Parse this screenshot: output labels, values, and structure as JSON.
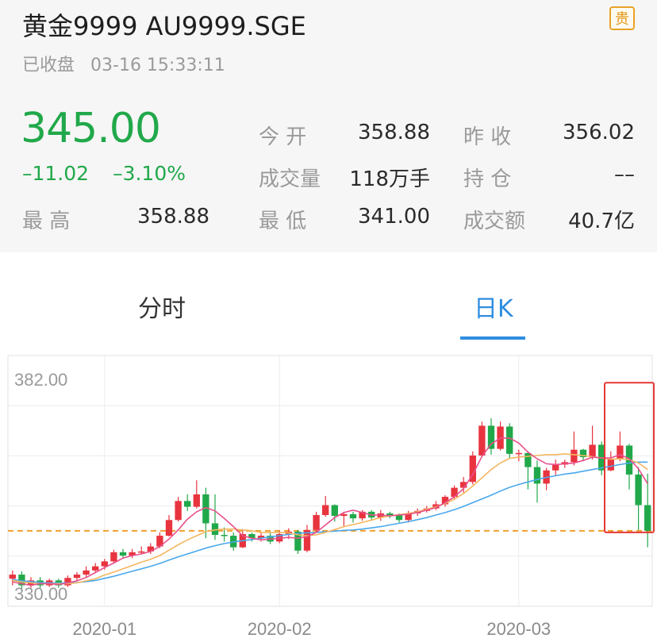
{
  "quote": {
    "title": "黄金9999 AU9999.SGE",
    "badge": "贵",
    "status": "已收盘",
    "time": "03-16 15:33:11",
    "price": "345.00",
    "change": "–11.02",
    "change_pct": "–3.10%",
    "colors": {
      "up": "#e8343f",
      "down": "#21a84a",
      "accent": "#2f8ee0",
      "badge": "#e8a228"
    },
    "stats": {
      "open_label": "今  开",
      "open": "358.88",
      "prev_close_label": "昨  收",
      "prev_close": "356.02",
      "volume_label": "成交量",
      "volume": "118万手",
      "position_label": "持  仓",
      "position": "––",
      "high_label": "最  高",
      "high": "358.88",
      "low_label": "最  低",
      "low": "341.00",
      "turnover_label": "成交额",
      "turnover": "40.7亿"
    }
  },
  "tabs": [
    {
      "label": "分时",
      "active": false
    },
    {
      "label": "日K",
      "active": true
    }
  ],
  "chart_data": {
    "type": "candlestick",
    "y_max_label": "382.00",
    "y_min_label": "330.00",
    "ylim": [
      330,
      382
    ],
    "x_tick_labels": [
      "2020-01",
      "2020-02",
      "2020-03"
    ],
    "reference_price": 345.0,
    "highlight_last": 5,
    "candles": [
      [
        333.4,
        334.4,
        331.8,
        335.4
      ],
      [
        334.4,
        331.8,
        330.4,
        335.2
      ],
      [
        331.8,
        333.0,
        331.2,
        333.8
      ],
      [
        333.0,
        331.8,
        331.2,
        333.8
      ],
      [
        331.8,
        333.0,
        331.4,
        333.4
      ],
      [
        333.0,
        331.8,
        331.2,
        333.4
      ],
      [
        331.8,
        333.6,
        331.4,
        334.2
      ],
      [
        333.6,
        334.4,
        333.0,
        335.0
      ],
      [
        334.4,
        335.4,
        333.8,
        336.4
      ],
      [
        335.4,
        336.4,
        334.8,
        337.2
      ],
      [
        336.4,
        337.6,
        335.6,
        338.2
      ],
      [
        337.6,
        339.8,
        337.2,
        340.4
      ],
      [
        339.8,
        339.0,
        338.4,
        340.6
      ],
      [
        339.0,
        339.8,
        338.4,
        340.6
      ],
      [
        339.8,
        340.0,
        339.4,
        341.2
      ],
      [
        340.0,
        341.2,
        339.4,
        342.0
      ],
      [
        341.2,
        343.8,
        340.8,
        344.6
      ],
      [
        343.8,
        347.6,
        343.6,
        348.8
      ],
      [
        347.6,
        352.2,
        347.2,
        353.2
      ],
      [
        352.2,
        350.8,
        349.8,
        353.8
      ],
      [
        350.8,
        353.8,
        350.4,
        357.2
      ],
      [
        353.8,
        346.8,
        343.2,
        355.4
      ],
      [
        346.8,
        344.0,
        342.8,
        353.8
      ],
      [
        344.0,
        343.8,
        342.4,
        345.8
      ],
      [
        343.8,
        341.0,
        340.2,
        344.6
      ],
      [
        341.0,
        344.2,
        340.8,
        345.4
      ],
      [
        344.2,
        343.2,
        342.4,
        344.6
      ],
      [
        343.2,
        343.8,
        342.4,
        344.6
      ],
      [
        343.8,
        342.4,
        341.8,
        344.6
      ],
      [
        342.4,
        344.2,
        342.0,
        345.0
      ],
      [
        344.2,
        344.8,
        343.0,
        345.6
      ],
      [
        344.8,
        340.2,
        339.4,
        345.2
      ],
      [
        340.2,
        345.2,
        339.8,
        346.4
      ],
      [
        345.2,
        348.8,
        344.6,
        349.6
      ],
      [
        348.8,
        351.2,
        348.4,
        353.4
      ],
      [
        351.2,
        348.6,
        347.2,
        351.4
      ],
      [
        348.6,
        349.0,
        346.0,
        349.6
      ],
      [
        349.0,
        348.0,
        347.0,
        349.6
      ],
      [
        348.0,
        349.6,
        347.4,
        350.0
      ],
      [
        349.6,
        348.2,
        347.4,
        350.0
      ],
      [
        348.2,
        349.2,
        347.4,
        350.0
      ],
      [
        349.2,
        348.8,
        348.0,
        349.6
      ],
      [
        348.8,
        347.6,
        347.0,
        349.2
      ],
      [
        347.6,
        349.2,
        347.0,
        349.8
      ],
      [
        349.2,
        349.8,
        348.6,
        350.4
      ],
      [
        349.8,
        350.4,
        349.4,
        351.0
      ],
      [
        350.4,
        351.4,
        350.0,
        352.2
      ],
      [
        351.4,
        353.2,
        350.8,
        353.6
      ],
      [
        353.2,
        355.4,
        352.6,
        356.0
      ],
      [
        355.4,
        356.8,
        354.2,
        358.0
      ],
      [
        356.8,
        363.2,
        356.2,
        364.2
      ],
      [
        363.2,
        370.4,
        362.8,
        371.4
      ],
      [
        370.4,
        364.8,
        363.4,
        372.2
      ],
      [
        364.8,
        370.2,
        364.4,
        371.4
      ],
      [
        370.2,
        363.6,
        362.4,
        371.0
      ],
      [
        363.6,
        363.8,
        361.8,
        364.6
      ],
      [
        363.8,
        360.4,
        355.0,
        364.2
      ],
      [
        360.4,
        356.4,
        351.8,
        362.0
      ],
      [
        356.4,
        359.6,
        354.8,
        360.2
      ],
      [
        359.6,
        361.0,
        358.4,
        362.2
      ],
      [
        361.0,
        361.6,
        360.2,
        362.2
      ],
      [
        361.6,
        364.6,
        360.8,
        369.0
      ],
      [
        364.6,
        362.8,
        361.8,
        364.8
      ],
      [
        362.8,
        365.8,
        362.2,
        370.4
      ],
      [
        365.8,
        359.6,
        358.4,
        366.6
      ],
      [
        359.6,
        362.4,
        359.4,
        364.2
      ],
      [
        362.4,
        365.6,
        361.8,
        369.0
      ],
      [
        365.6,
        358.6,
        355.0,
        366.0
      ],
      [
        358.6,
        351.2,
        345.2,
        360.4
      ],
      [
        351.2,
        345.0,
        341.0,
        358.8
      ]
    ],
    "ma5": [
      332.6,
      332.2,
      331.8,
      332.2,
      332.2,
      332.0,
      332.4,
      332.9,
      333.7,
      334.9,
      336.1,
      337.2,
      338.4,
      339.0,
      339.4,
      340.0,
      341.2,
      343.0,
      345.2,
      347.8,
      349.6,
      350.6,
      349.8,
      348.0,
      346.0,
      343.8,
      343.2,
      342.8,
      343.0,
      343.2,
      343.4,
      343.2,
      343.6,
      344.6,
      346.4,
      348.2,
      349.4,
      350.0,
      349.4,
      348.8,
      348.8,
      348.6,
      348.8,
      349.0,
      349.4,
      350.0,
      350.6,
      351.8,
      353.2,
      355.2,
      358.6,
      363.0,
      366.0,
      367.4,
      367.4,
      366.2,
      364.0,
      362.4,
      361.2,
      361.0,
      361.2,
      361.4,
      362.0,
      362.8,
      362.6,
      362.6,
      363.4,
      362.4,
      360.0,
      356.4
    ],
    "ma10": [
      333.0,
      332.6,
      332.4,
      332.2,
      332.2,
      332.2,
      332.2,
      332.4,
      332.9,
      333.4,
      334.3,
      335.0,
      335.8,
      336.6,
      337.4,
      338.1,
      339.0,
      340.3,
      341.6,
      342.8,
      343.8,
      344.8,
      345.2,
      345.4,
      345.4,
      345.2,
      345.0,
      344.6,
      344.6,
      344.6,
      344.5,
      344.0,
      343.8,
      344.0,
      344.6,
      345.3,
      346.0,
      346.5,
      347.0,
      347.6,
      348.2,
      348.6,
      348.9,
      349.2,
      349.6,
      350.2,
      350.8,
      351.6,
      352.6,
      354.0,
      355.8,
      357.8,
      359.8,
      361.4,
      362.5,
      362.8,
      363.0,
      363.2,
      363.4,
      363.4,
      363.6,
      363.4,
      363.2,
      362.9,
      362.6,
      362.3,
      362.4,
      362.2,
      361.4,
      359.8
    ],
    "ma20": [
      333.2,
      332.9,
      332.7,
      332.5,
      332.4,
      332.4,
      332.4,
      332.5,
      332.7,
      333.0,
      333.5,
      334.0,
      334.6,
      335.2,
      335.8,
      336.4,
      337.1,
      337.9,
      338.7,
      339.4,
      340.1,
      340.8,
      341.4,
      341.9,
      342.3,
      342.6,
      342.9,
      343.2,
      343.5,
      343.8,
      344.1,
      344.4,
      344.5,
      344.6,
      344.8,
      344.9,
      345.1,
      345.2,
      345.4,
      345.7,
      346.0,
      346.4,
      346.8,
      347.2,
      347.7,
      348.2,
      348.8,
      349.4,
      350.1,
      350.9,
      351.8,
      352.7,
      353.6,
      354.6,
      355.5,
      356.2,
      356.8,
      357.4,
      357.9,
      358.3,
      358.7,
      359.0,
      359.4,
      359.8,
      360.2,
      360.6,
      361.0,
      361.4,
      361.6,
      361.6
    ]
  }
}
